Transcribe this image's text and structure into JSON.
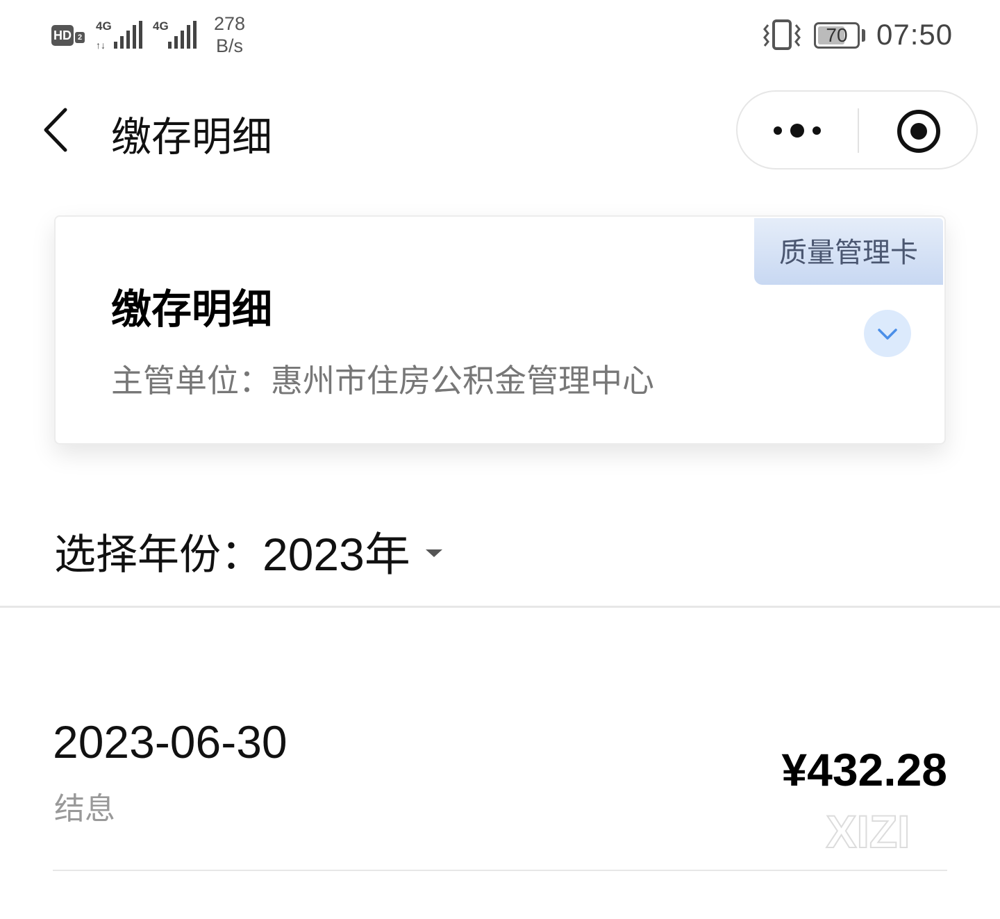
{
  "status_bar": {
    "hd_label": "HD",
    "hd_sub": "2",
    "sim1_network": "4G",
    "sim2_network": "4G",
    "speed_value": "278",
    "speed_unit": "B/s",
    "battery_level": "70",
    "time": "07:50",
    "icons": [
      "hd-icon",
      "signal-icon",
      "signal-icon",
      "vibrate-icon",
      "battery-icon"
    ]
  },
  "nav": {
    "back_icon": "chevron-left-icon",
    "title": "缴存明细",
    "more_icon": "more-dots-icon",
    "close_icon": "target-close-icon"
  },
  "card": {
    "tag": "质量管理卡",
    "title": "缴存明细",
    "authority_label": "主管单位：",
    "authority_value": "惠州市住房公积金管理中心",
    "expand_icon": "chevron-down-icon",
    "colors": {
      "tag_bg": "#d3e0f5",
      "expand_bg": "#dceafc",
      "accent": "#4a8ee8"
    }
  },
  "year_selector": {
    "label": "选择年份：",
    "value": "2023年",
    "caret_icon": "caret-down-icon"
  },
  "records": [
    {
      "date": "2023-06-30",
      "type": "结息",
      "amount": "¥432.28"
    }
  ],
  "watermark": "XIZI"
}
